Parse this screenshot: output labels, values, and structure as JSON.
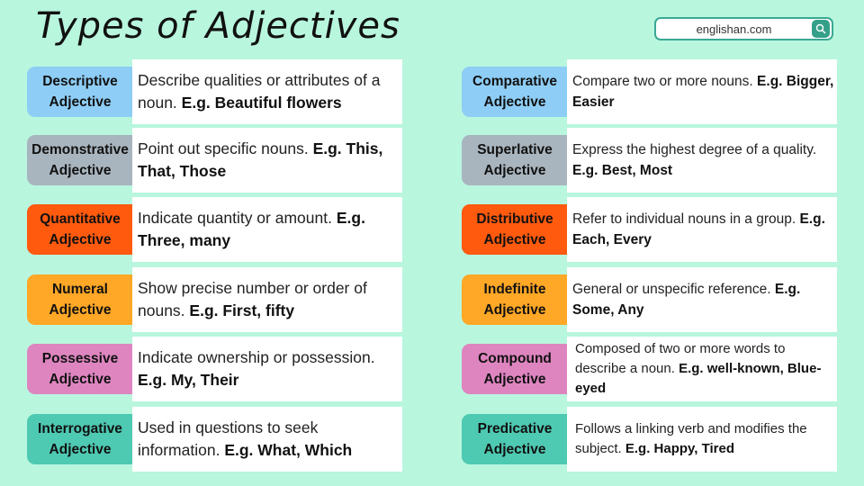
{
  "title": "Types of Adjectives",
  "search": {
    "text": "englishan.com",
    "icon": "search-icon",
    "color": "#35a08a"
  },
  "left": [
    {
      "name": "Descriptive",
      "sub": "Adjective",
      "color": "#8ecdf5",
      "desc": "Describe qualities or attributes of a noun.",
      "eg": "E.g. Beautiful flowers"
    },
    {
      "name": "Demonstrative",
      "sub": "Adjective",
      "color": "#a9b5be",
      "desc": "Point out specific nouns.",
      "eg": "E.g. This, That, Those"
    },
    {
      "name": "Quantitative",
      "sub": "Adjective",
      "color": "#ff5a0e",
      "desc": "Indicate quantity or amount.",
      "eg": "E.g. Three, many"
    },
    {
      "name": "Numeral",
      "sub": "Adjective",
      "color": "#ffa726",
      "desc": "Show precise number or order of nouns.",
      "eg": "E.g. First, fifty"
    },
    {
      "name": "Possessive",
      "sub": "Adjective",
      "color": "#de85c0",
      "desc": "Indicate ownership or possession.",
      "eg": "E.g. My, Their"
    },
    {
      "name": "Interrogative",
      "sub": "Adjective",
      "color": "#4ec9b2",
      "desc": "Used in questions to seek information.",
      "eg": "E.g. What, Which"
    }
  ],
  "right": [
    {
      "name": "Comparative",
      "sub": "Adjective",
      "color": "#8ecdf5",
      "desc": "Compare two or more nouns.",
      "eg": "E.g. Bigger, Easier"
    },
    {
      "name": "Superlative",
      "sub": "Adjective",
      "color": "#a9b5be",
      "desc": "Express the highest degree of a quality.",
      "eg": "E.g. Best, Most"
    },
    {
      "name": "Distributive",
      "sub": "Adjective",
      "color": "#ff5a0e",
      "desc": "Refer to individual nouns in a group.",
      "eg": "E.g. Each, Every"
    },
    {
      "name": "Indefinite",
      "sub": "Adjective",
      "color": "#ffa726",
      "desc": "General or unspecific reference.",
      "eg": "E.g. Some, Any"
    },
    {
      "name": "Compound",
      "sub": "Adjective",
      "color": "#de85c0",
      "desc": "Composed of two or more words to describe a noun.",
      "eg": "E.g. well-known, Blue-eyed"
    },
    {
      "name": "Predicative",
      "sub": "Adjective",
      "color": "#4ec9b2",
      "desc": "Follows a linking verb and modifies the subject.",
      "eg": "E.g. Happy, Tired"
    }
  ]
}
